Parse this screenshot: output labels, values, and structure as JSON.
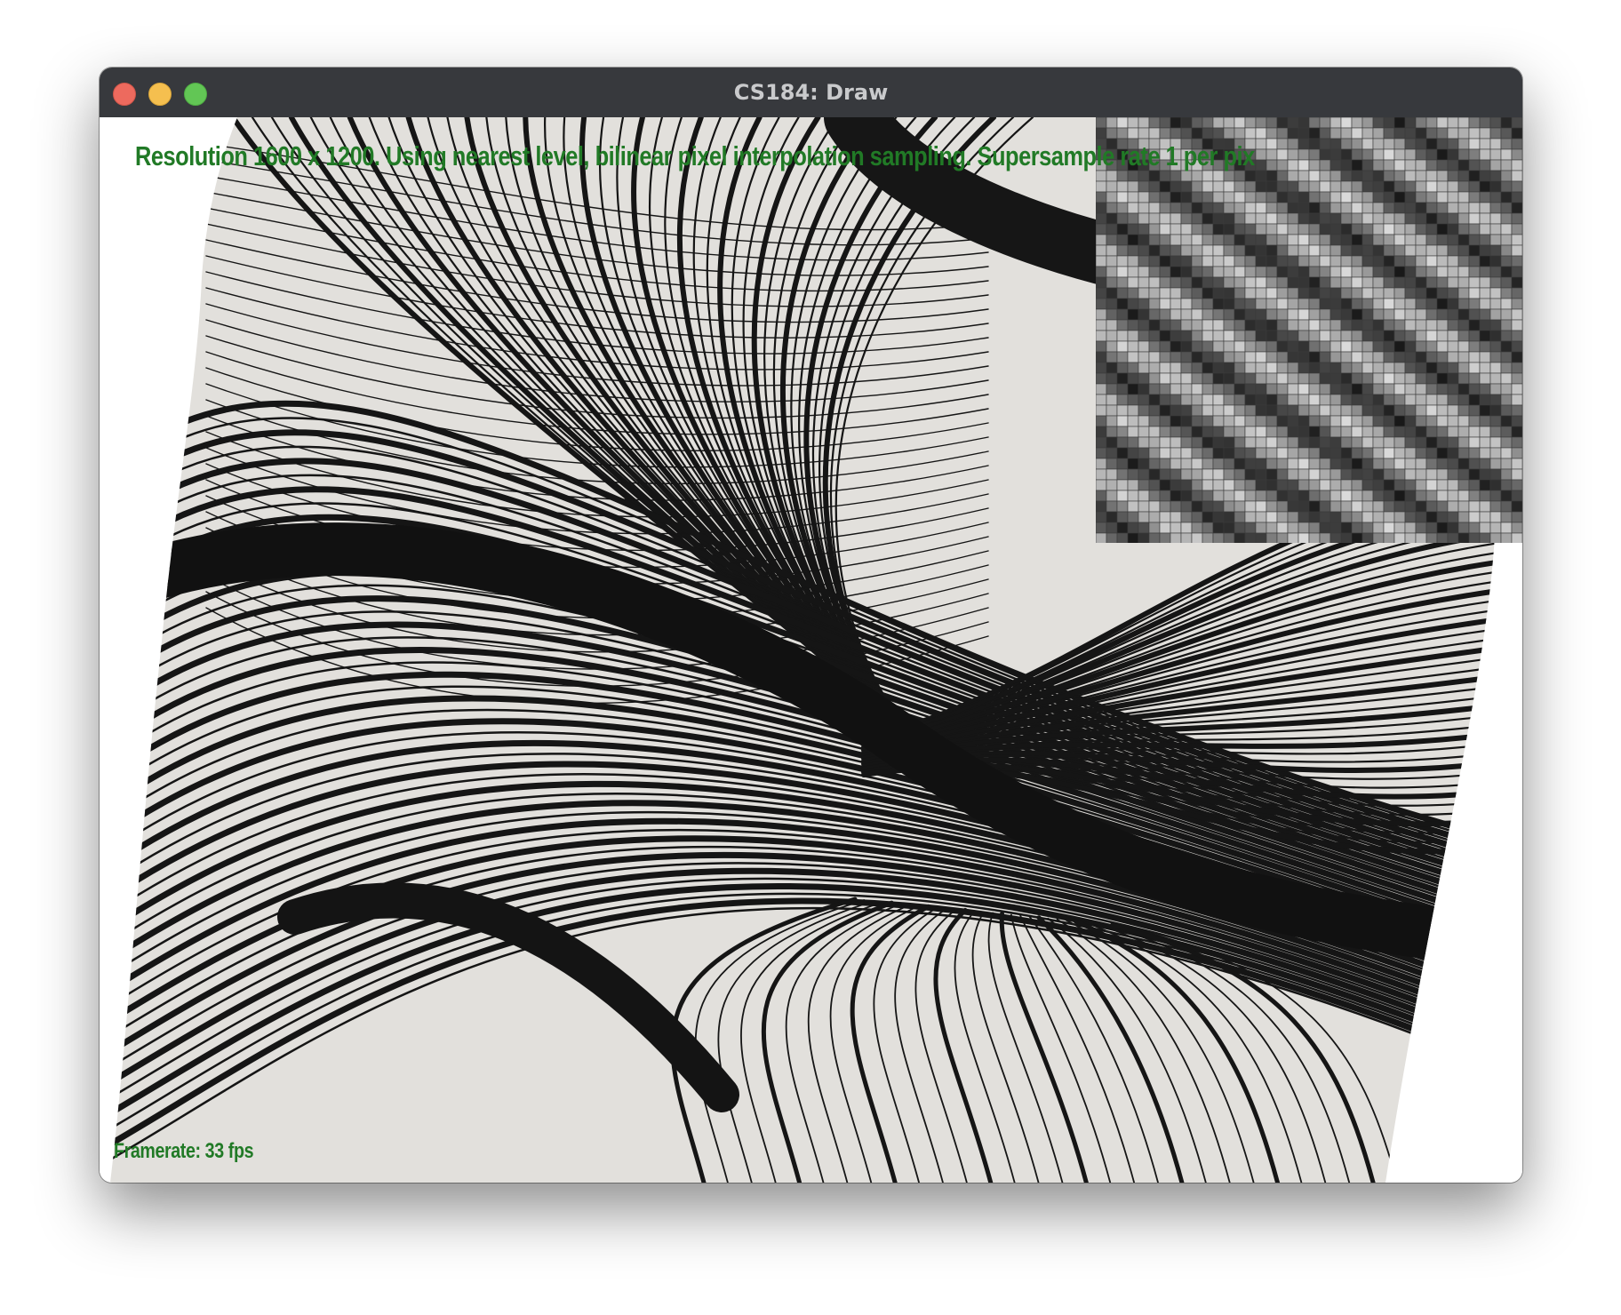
{
  "window": {
    "title": "CS184: Draw",
    "controls": [
      "close",
      "minimize",
      "maximize"
    ]
  },
  "overlay": {
    "status": "Resolution 1600 x 1200. Using nearest level, bilinear pixel interpolation sampling. Supersample rate 1 per pix",
    "framerate": "Framerate: 33 fps"
  },
  "colors": {
    "titlebar": "#37393d",
    "overlay_text": "#217a26",
    "close": "#ed6a5e",
    "minimize": "#f5bf4f",
    "maximize": "#62c655"
  }
}
